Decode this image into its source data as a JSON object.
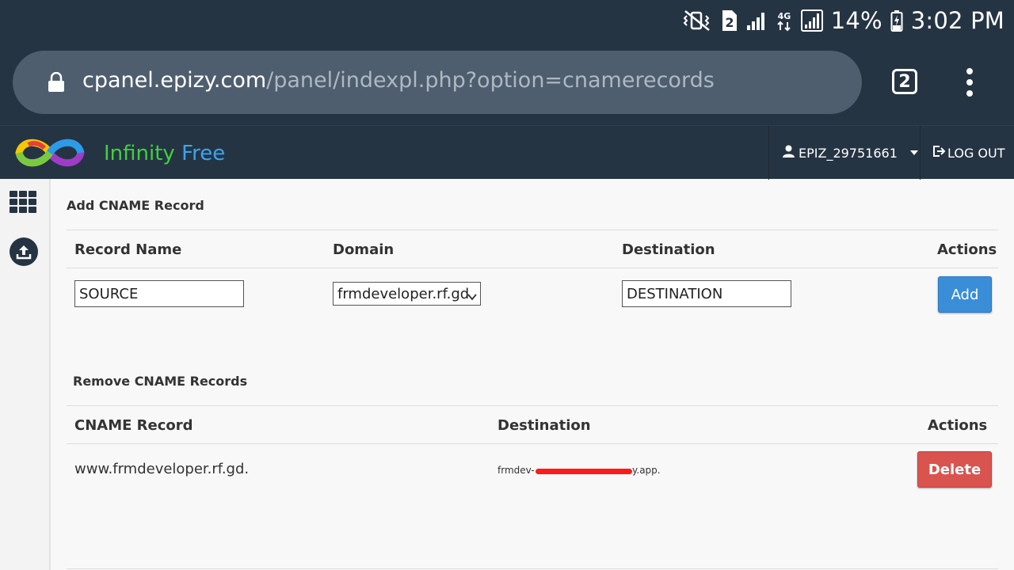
{
  "status_bar": {
    "battery_percent": "14%",
    "time": "3:02 PM",
    "sim_number": "2",
    "network_type": "4G",
    "icons": [
      "vibrate-mute-icon",
      "sim-2-icon",
      "signal-icon",
      "network-4g-icon",
      "signal-icon",
      "battery-charging-icon"
    ]
  },
  "browser": {
    "url_host": "cpanel.epizy.com",
    "url_path": "/panel/indexpl.php?option=cnamerecords",
    "tab_count": "2",
    "icons": [
      "lock-icon",
      "tabs-icon",
      "more-vert-icon"
    ]
  },
  "header": {
    "brand_part1": "Infinity",
    "brand_part2": " Free",
    "username": "EPIZ_29751661",
    "logout_label": "LOG OUT",
    "colors": {
      "bg": "#253443",
      "brand_green": "#3fd13c",
      "brand_blue": "#3aa5f0"
    }
  },
  "sidebar": {
    "icons": [
      "apps-grid-icon",
      "upload-icon"
    ]
  },
  "add_section": {
    "title": "Add CNAME Record",
    "columns": [
      "Record Name",
      "Domain",
      "Destination",
      "Actions"
    ],
    "record_name_value": "SOURCE",
    "domain_selected": "frmdeveloper.rf.gd",
    "destination_value": "DESTINATION",
    "add_label": "Add"
  },
  "remove_section": {
    "title": "Remove CNAME Records",
    "columns": [
      "CNAME Record",
      "Destination",
      "Actions"
    ],
    "rows": [
      {
        "record": "www.frmdeveloper.rf.gd.",
        "destination_prefix": "frmdev-",
        "destination_suffix": "y.app.",
        "delete_label": "Delete"
      }
    ]
  },
  "colors": {
    "add_button": "#3a8ed8",
    "delete_button": "#d9534f",
    "redaction": "#ff1a1a"
  }
}
